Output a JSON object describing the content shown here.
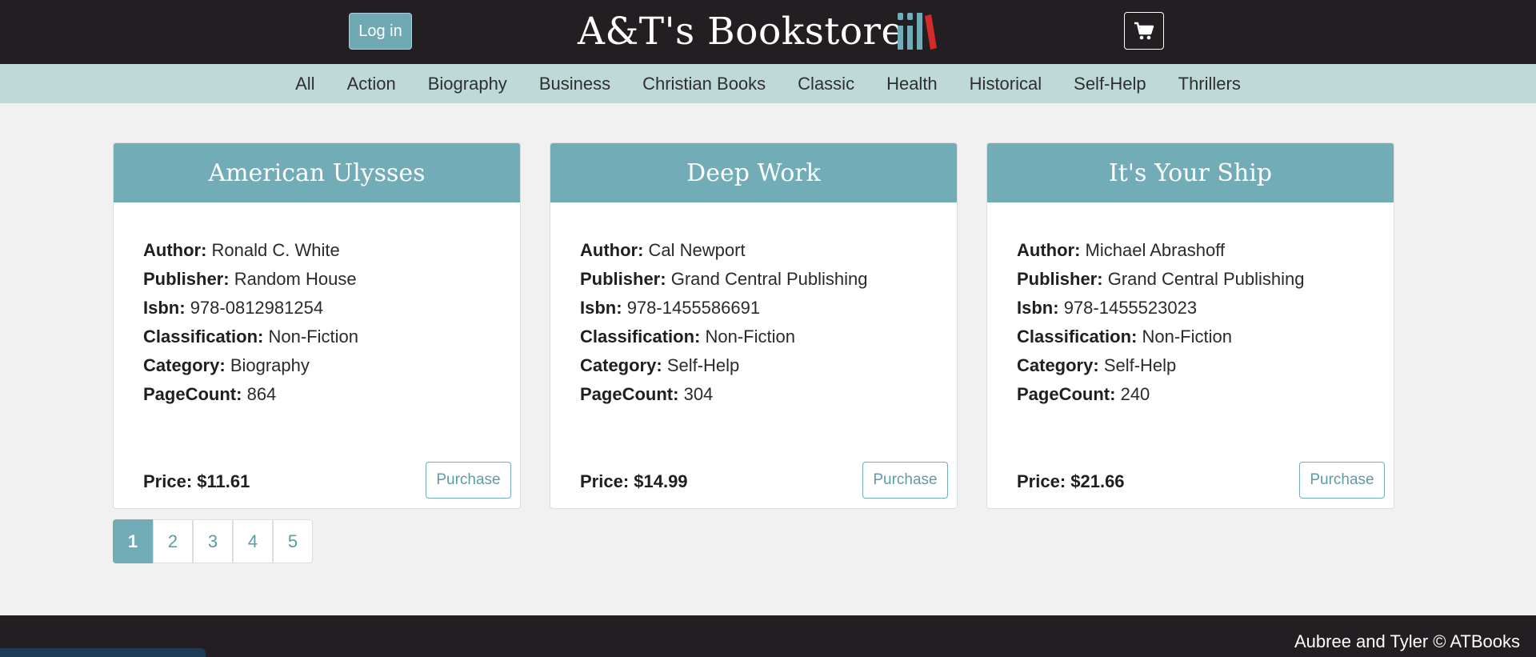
{
  "header": {
    "login_label": "Log in",
    "brand_title": "A&T's Bookstore",
    "logo_icon": "books-icon",
    "cart_icon": "shopping-cart-icon",
    "colors": {
      "bar": "#231e21",
      "accent": "#72acb7",
      "logo_red": "#d42a2a",
      "logo_teal": "#72acb7"
    }
  },
  "categories": [
    "All",
    "Action",
    "Biography",
    "Business",
    "Christian Books",
    "Classic",
    "Health",
    "Historical",
    "Self-Help",
    "Thrillers"
  ],
  "books": [
    {
      "title": "American Ulysses",
      "author_label": "Author:",
      "author": "Ronald C. White",
      "publisher_label": "Publisher:",
      "publisher": "Random House",
      "isbn_label": "Isbn:",
      "isbn": "978-0812981254",
      "classification_label": "Classification:",
      "classification": "Non-Fiction",
      "category_label": "Category:",
      "category": "Biography",
      "pagecount_label": "PageCount:",
      "pagecount": "864",
      "price": "Price: $11.61",
      "purchase_label": "Purchase"
    },
    {
      "title": "Deep Work",
      "author_label": "Author:",
      "author": "Cal Newport",
      "publisher_label": "Publisher:",
      "publisher": "Grand Central Publishing",
      "isbn_label": "Isbn:",
      "isbn": "978-1455586691",
      "classification_label": "Classification:",
      "classification": "Non-Fiction",
      "category_label": "Category:",
      "category": "Self-Help",
      "pagecount_label": "PageCount:",
      "pagecount": "304",
      "price": "Price: $14.99",
      "purchase_label": "Purchase"
    },
    {
      "title": "It's Your Ship",
      "author_label": "Author:",
      "author": "Michael Abrashoff",
      "publisher_label": "Publisher:",
      "publisher": "Grand Central Publishing",
      "isbn_label": "Isbn:",
      "isbn": "978-1455523023",
      "classification_label": "Classification:",
      "classification": "Non-Fiction",
      "category_label": "Category:",
      "category": "Self-Help",
      "pagecount_label": "PageCount:",
      "pagecount": "240",
      "price": "Price: $21.66",
      "purchase_label": "Purchase"
    }
  ],
  "pagination": {
    "pages": [
      "1",
      "2",
      "3",
      "4",
      "5"
    ],
    "current": "1"
  },
  "footer": {
    "text": "Aubree and Tyler © ATBooks"
  }
}
